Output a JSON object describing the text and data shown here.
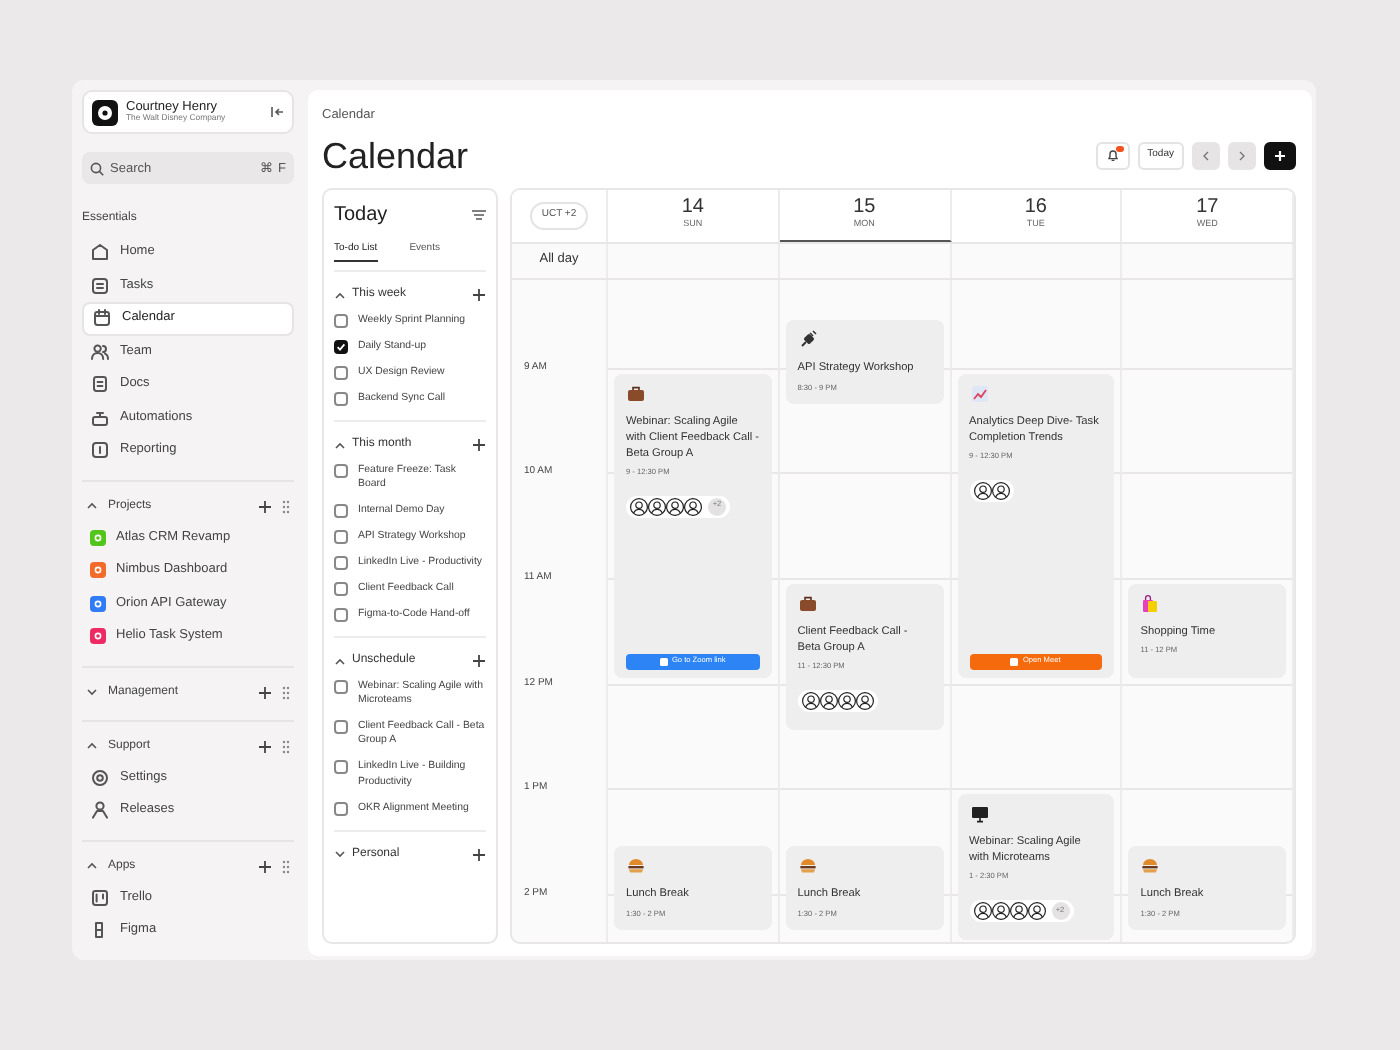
{
  "user": {
    "name": "Courtney Henry",
    "company": "The Walt Disney Company"
  },
  "search": {
    "placeholder": "Search",
    "shortcut": "⌘ F"
  },
  "sidebar": [
    {
      "title": "Essentials",
      "kind": "plain",
      "items": [
        {
          "label": "Home",
          "kind": "home",
          "selected": false
        },
        {
          "label": "Tasks",
          "kind": "tasks",
          "selected": false
        },
        {
          "label": "Calendar",
          "kind": "calendar",
          "selected": true
        },
        {
          "label": "Team",
          "kind": "team",
          "selected": false
        },
        {
          "label": "Docs",
          "kind": "docs",
          "selected": false
        },
        {
          "label": "Automations",
          "kind": "automations",
          "selected": false
        },
        {
          "label": "Reporting",
          "kind": "reporting",
          "selected": false
        }
      ]
    },
    {
      "title": "Projects",
      "kind": "group",
      "expanded": true,
      "items": [
        {
          "label": "Atlas CRM Revamp",
          "kind": "project",
          "color": "#52c41a",
          "selected": false
        },
        {
          "label": "Nimbus Dashboard",
          "kind": "project",
          "color": "#f26b2a",
          "selected": false
        },
        {
          "label": "Orion API Gateway",
          "kind": "project",
          "color": "#2f7cf6",
          "selected": false
        },
        {
          "label": "Helio Task System",
          "kind": "project",
          "color": "#ee2a64",
          "selected": false
        }
      ]
    },
    {
      "title": "Management",
      "kind": "group",
      "expanded": false
    },
    {
      "title": "Support",
      "kind": "group",
      "expanded": true,
      "items": [
        {
          "label": "Settings",
          "kind": "settings",
          "selected": false
        },
        {
          "label": "Releases",
          "kind": "releases",
          "selected": false
        }
      ]
    },
    {
      "title": "Apps",
      "kind": "group",
      "expanded": true,
      "items": [
        {
          "label": "Trello",
          "kind": "trello",
          "selected": false
        },
        {
          "label": "Figma",
          "kind": "figma",
          "selected": false
        }
      ]
    }
  ],
  "breadcrumb": "Calendar",
  "title": "Calendar",
  "toolbar": {
    "notifications_unread": true,
    "today": "Today"
  },
  "todo": {
    "title": "Today",
    "tabs": [
      {
        "label": "To-do List",
        "selected": true
      },
      {
        "label": "Events",
        "selected": false
      }
    ],
    "groups": [
      {
        "title": "This week",
        "expanded": true,
        "items": [
          {
            "label": "Weekly Sprint Planning",
            "checked": false
          },
          {
            "label": "Daily Stand-up",
            "checked": true
          },
          {
            "label": "UX Design Review",
            "checked": false
          },
          {
            "label": "Backend Sync Call",
            "checked": false
          }
        ]
      },
      {
        "title": "This month",
        "expanded": true,
        "items": [
          {
            "label": "Feature Freeze: Task Board",
            "checked": false
          },
          {
            "label": "Internal Demo Day",
            "checked": false
          },
          {
            "label": "API Strategy Workshop",
            "checked": false
          },
          {
            "label": "LinkedIn Live - Productivity",
            "checked": false
          },
          {
            "label": "Client Feedback Call",
            "checked": false
          },
          {
            "label": "Figma-to-Code Hand-off",
            "checked": false
          }
        ]
      },
      {
        "title": "Unschedule",
        "expanded": true,
        "items": [
          {
            "label": "Webinar: Scaling Agile with Microteams",
            "checked": false
          },
          {
            "label": "Client Feedback Call - Beta Group A",
            "checked": false
          },
          {
            "label": "LinkedIn Live - Building Productivity",
            "checked": false
          },
          {
            "label": "OKR Alignment Meeting",
            "checked": false
          }
        ]
      },
      {
        "title": "Personal",
        "expanded": false
      }
    ]
  },
  "calendar": {
    "timezone": "UCT +2",
    "all_day": "All day",
    "hours": [
      "9 AM",
      "10 AM",
      "11 AM",
      "12 PM",
      "1 PM",
      "2 PM"
    ],
    "days": [
      {
        "date": "14",
        "weekday": "SUN",
        "selected": false,
        "events": [
          {
            "kind": "briefcase",
            "title": "Webinar: Scaling Agile with Client Feedback Call - Beta Group A",
            "time": "9 - 12:30 PM",
            "avatars": [
              {
                "kind": "person"
              },
              {
                "kind": "person"
              },
              {
                "kind": "person"
              },
              {
                "kind": "person"
              }
            ],
            "more": "+2",
            "button": {
              "label": "Go to Zoom link",
              "color": "#2d84f5"
            }
          },
          {
            "kind": "burger",
            "title": "Lunch Break",
            "time": "1:30 - 2 PM"
          }
        ]
      },
      {
        "date": "15",
        "weekday": "MON",
        "selected": true,
        "events": [
          {
            "kind": "plug",
            "title": "API Strategy Workshop",
            "time": "8:30 - 9 PM"
          },
          {
            "kind": "briefcase",
            "title": "Client Feedback Call - Beta Group A",
            "time": "11 - 12:30 PM",
            "avatars": [
              {
                "kind": "person"
              },
              {
                "kind": "person"
              },
              {
                "kind": "person"
              },
              {
                "kind": "person"
              }
            ]
          },
          {
            "kind": "burger",
            "title": "Lunch Break",
            "time": "1:30 - 2 PM"
          }
        ]
      },
      {
        "date": "16",
        "weekday": "TUE",
        "selected": false,
        "events": [
          {
            "kind": "chart",
            "title": "Analytics Deep Dive- Task Completion Trends",
            "time": "9 - 12:30 PM",
            "avatars": [
              {
                "kind": "person"
              },
              {
                "kind": "person"
              }
            ],
            "button": {
              "label": "Open Meet",
              "color": "#f56a0c"
            }
          },
          {
            "kind": "monitor",
            "title": "Webinar: Scaling Agile with Microteams",
            "time": "1 - 2:30 PM",
            "avatars": [
              {
                "kind": "person"
              },
              {
                "kind": "person"
              },
              {
                "kind": "person"
              },
              {
                "kind": "person"
              }
            ],
            "more": "+2"
          }
        ]
      },
      {
        "date": "17",
        "weekday": "WED",
        "selected": false,
        "events": [
          {
            "kind": "bags",
            "title": "Shopping Time",
            "time": "11 - 12 PM"
          },
          {
            "kind": "burger",
            "title": "Lunch Break",
            "time": "1:30 - 2 PM"
          }
        ]
      }
    ]
  }
}
